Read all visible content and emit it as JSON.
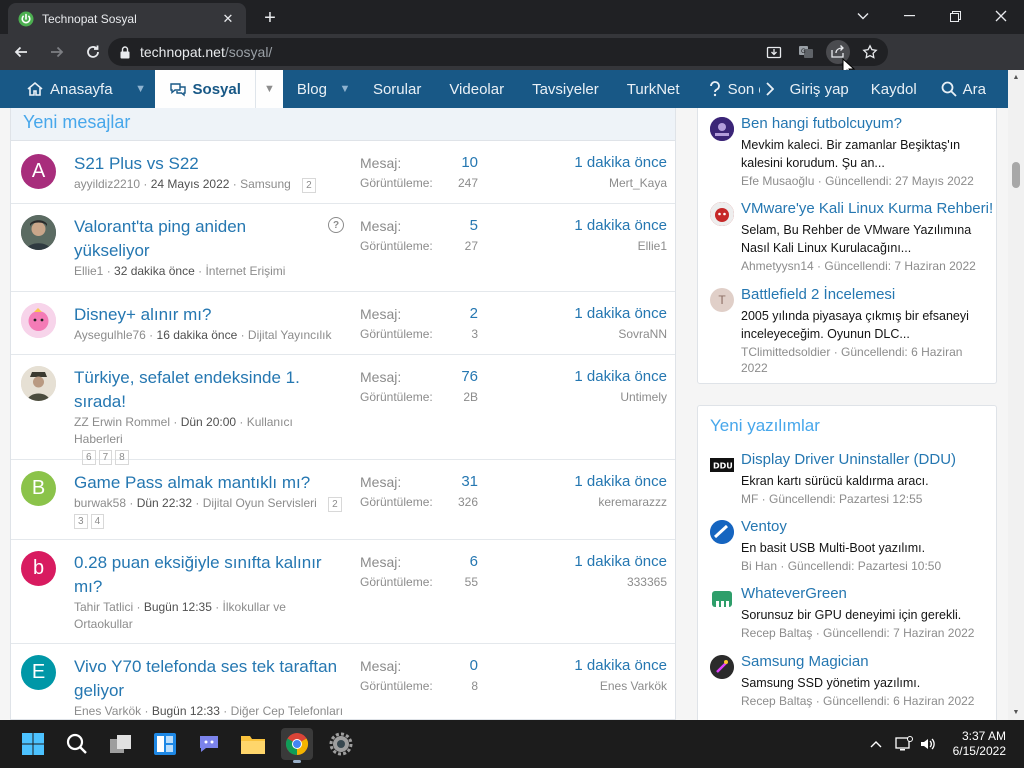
{
  "browser": {
    "tab_title": "Technopat Sosyal",
    "tab_close": "✕",
    "new_tab": "+",
    "url_host": "technopat.net",
    "url_path": "/sosyal/"
  },
  "nav": {
    "home": "Anasayfa",
    "social": "Sosyal",
    "blog": "Blog",
    "questions": "Sorular",
    "videos": "Videolar",
    "recommendations": "Tavsiyeler",
    "turknet": "TurkNet",
    "recent": "Son e",
    "login": "Giriş yap",
    "register": "Kaydol",
    "search": "Ara"
  },
  "main": {
    "header": "Yeni mesajlar",
    "label_messages": "Mesaj:",
    "label_views": "Görüntüleme:",
    "threads": [
      {
        "title": "S21 Plus vs S22",
        "author": "ayyildiz2210",
        "date": "24 Mayıs 2022",
        "forum": "Samsung",
        "pages": [
          "2"
        ],
        "messages": "10",
        "views": "247",
        "last_time": "1 dakika önce",
        "last_user": "Mert_Kaya",
        "avatar_letter": "A"
      },
      {
        "title": "Valorant'ta ping aniden yükseliyor",
        "author": "Ellie1",
        "date": "32 dakika önce",
        "forum": "İnternet Erişimi",
        "pages": [],
        "messages": "5",
        "views": "27",
        "last_time": "1 dakika önce",
        "last_user": "Ellie1",
        "avatar_letter": ""
      },
      {
        "title": "Disney+ alınır mı?",
        "author": "Aysegulhle76",
        "date": "16 dakika önce",
        "forum": "Dijital Yayıncılık",
        "pages": [],
        "messages": "2",
        "views": "3",
        "last_time": "1 dakika önce",
        "last_user": "SovraNN",
        "avatar_letter": ""
      },
      {
        "title": "Türkiye, sefalet endeksinde 1. sırada!",
        "author": "ZZ Erwin Rommel",
        "date": "Dün 20:00",
        "forum": "Kullanıcı Haberleri",
        "pages": [
          "6",
          "7",
          "8"
        ],
        "messages": "76",
        "views": "2B",
        "last_time": "1 dakika önce",
        "last_user": "Untimely",
        "avatar_letter": ""
      },
      {
        "title": "Game Pass almak mantıklı mı?",
        "author": "burwak58",
        "date": "Dün 22:32",
        "forum": "Dijital Oyun Servisleri",
        "pages": [
          "2",
          "3",
          "4"
        ],
        "messages": "31",
        "views": "326",
        "last_time": "1 dakika önce",
        "last_user": "keremarazzz",
        "avatar_letter": "B"
      },
      {
        "title": "0.28 puan eksiğiyle sınıfta kalınır mı?",
        "author": "Tahir Tatlici",
        "date": "Bugün 12:35",
        "forum": "İlkokullar ve Ortaokullar",
        "pages": [],
        "messages": "6",
        "views": "55",
        "last_time": "1 dakika önce",
        "last_user": "333365",
        "avatar_letter": "b"
      },
      {
        "title": "Vivo Y70 telefonda ses tek taraftan geliyor",
        "author": "Enes Varkök",
        "date": "Bugün 12:33",
        "forum": "Diğer Cep Telefonları",
        "pages": [],
        "messages": "0",
        "views": "8",
        "last_time": "1 dakika önce",
        "last_user": "Enes Varkök",
        "avatar_letter": "E"
      }
    ]
  },
  "sidebar_top": {
    "items": [
      {
        "title": "Ben hangi futbolcuyum?",
        "desc": "Mevkim kaleci. Bir zamanlar Beşiktaş'ın kalesini korudum. Şu an...",
        "author": "Efe Musaoğlu",
        "updated": "Güncellendi: 27 Mayıs 2022"
      },
      {
        "title": "VMware'ye Kali Linux Kurma Rehberi!",
        "desc": "Selam, Bu Rehber de VMware Yazılımına Nasıl Kali Linux Kurulacağını...",
        "author": "Ahmetyysn14",
        "updated": "Güncellendi: 7 Haziran 2022"
      },
      {
        "title": "Battlefield 2 İncelemesi",
        "desc": "2005 yılında piyasaya çıkmış bir efsaneyi inceleyeceğim. Oyunun DLC...",
        "author": "TClimittedsoldier",
        "updated": "Güncellendi: 6 Haziran 2022",
        "avatar_letter": "T"
      }
    ]
  },
  "sidebar_software": {
    "title": "Yeni yazılımlar",
    "items": [
      {
        "title": "Display Driver Uninstaller (DDU)",
        "desc": "Ekran kartı sürücü kaldırma aracı.",
        "author": "MF",
        "updated": "Güncellendi: Pazartesi 12:55"
      },
      {
        "title": "Ventoy",
        "desc": "En basit USB Multi-Boot yazılımı.",
        "author": "Bi Han",
        "updated": "Güncellendi: Pazartesi 10:50"
      },
      {
        "title": "WhateverGreen",
        "desc": "Sorunsuz bir GPU deneyimi için gerekli.",
        "author": "Recep Baltaş",
        "updated": "Güncellendi: 7 Haziran 2022"
      },
      {
        "title": "Samsung Magician",
        "desc": "Samsung SSD yönetim yazılımı.",
        "author": "Recep Baltaş",
        "updated": "Güncellendi: 6 Haziran 2022"
      }
    ]
  },
  "taskbar": {
    "time": "3:37 AM",
    "date": "6/15/2022"
  },
  "colors": {
    "nav_bg": "#185886",
    "link": "#2577b1",
    "header_text": "#47a7eb",
    "muted": "#8c8c8c"
  }
}
